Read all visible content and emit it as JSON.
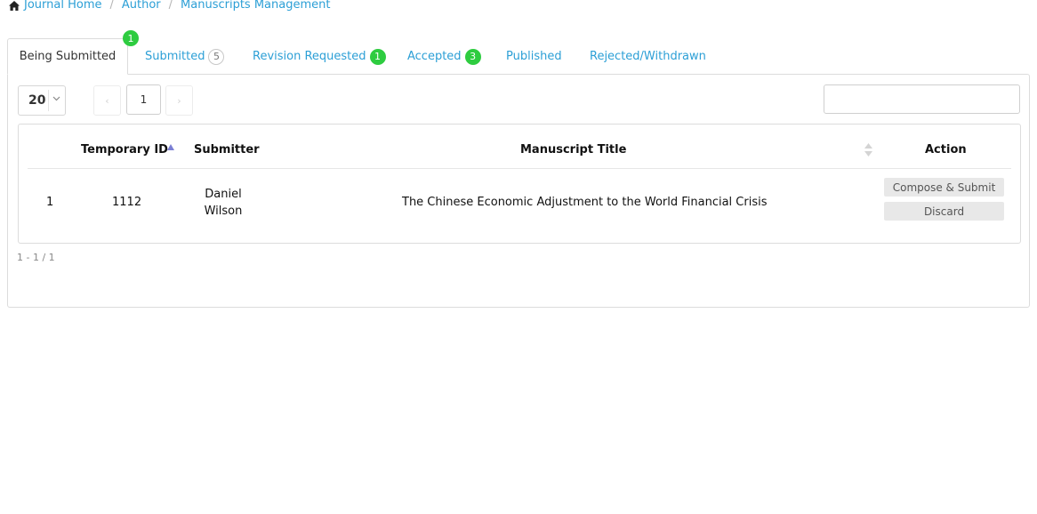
{
  "breadcrumb": {
    "home": "Journal Home",
    "author": "Author",
    "current": "Manuscripts Management",
    "separator": "/"
  },
  "tabs": [
    {
      "label": "Being Submitted",
      "badge": "1",
      "active": true
    },
    {
      "label": "Submitted",
      "badge": "5"
    },
    {
      "label": "Revision Requested",
      "badge": "1"
    },
    {
      "label": "Accepted",
      "badge": "3"
    },
    {
      "label": "Published",
      "badge": ""
    },
    {
      "label": "Rejected/Withdrawn",
      "badge": ""
    }
  ],
  "controls": {
    "page_size": "20",
    "current_page": "1",
    "prev_label": "‹",
    "next_label": "›",
    "search_placeholder": ""
  },
  "table": {
    "columns": {
      "temporary_id": "Temporary ID",
      "submitter": "Submitter",
      "title": "Manuscript Title",
      "action": "Action"
    },
    "rows": [
      {
        "index": "1",
        "temporary_id": "1112",
        "submitter_first": "Daniel",
        "submitter_last": "Wilson",
        "title": "The Chinese Economic Adjustment to the World Financial Crisis",
        "actions": [
          "Compose & Submit",
          "Discard"
        ]
      }
    ]
  },
  "range_text": "1 - 1 / 1",
  "colors": {
    "link": "#2c9fd6",
    "badge_green": "#2ecc40",
    "sort_active": "#7b7fd4"
  }
}
